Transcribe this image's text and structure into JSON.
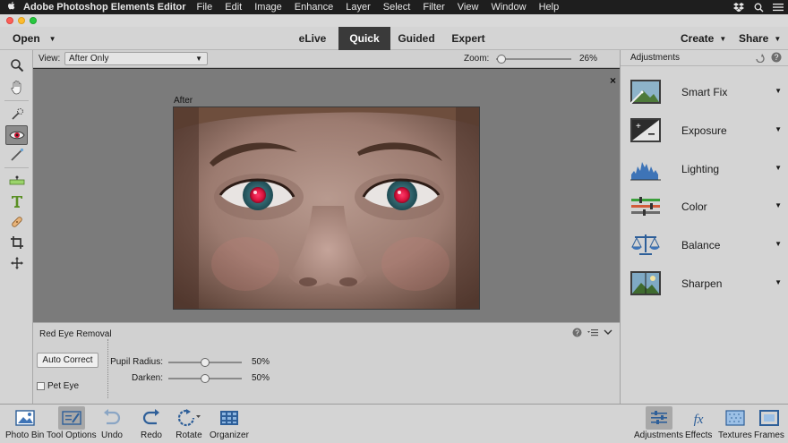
{
  "menubar": {
    "app_name": "Adobe Photoshop Elements Editor",
    "items": [
      "File",
      "Edit",
      "Image",
      "Enhance",
      "Layer",
      "Select",
      "Filter",
      "View",
      "Window",
      "Help"
    ],
    "icons": [
      "dropbox-icon",
      "search-icon",
      "list-icon"
    ]
  },
  "modebar": {
    "open_label": "Open",
    "modes": [
      {
        "label": "eLive",
        "active": false
      },
      {
        "label": "Quick",
        "active": true
      },
      {
        "label": "Guided",
        "active": false
      },
      {
        "label": "Expert",
        "active": false
      }
    ],
    "create_label": "Create",
    "share_label": "Share"
  },
  "viewbar": {
    "view_label": "View:",
    "view_value": "After Only",
    "zoom_label": "Zoom:",
    "zoom_value": "26%"
  },
  "canvas": {
    "after_label": "After",
    "close_label": "×"
  },
  "tool_options": {
    "title": "Red Eye Removal",
    "auto_correct_label": "Auto Correct",
    "pet_eye_label": "Pet Eye",
    "pet_eye_checked": false,
    "sliders": [
      {
        "label": "Pupil Radius:",
        "value": "50%",
        "fraction": 0.5
      },
      {
        "label": "Darken:",
        "value": "50%",
        "fraction": 0.5
      }
    ]
  },
  "adjustments": {
    "title": "Adjustments",
    "items": [
      {
        "label": "Smart Fix",
        "icon": "smart-fix-icon"
      },
      {
        "label": "Exposure",
        "icon": "exposure-icon"
      },
      {
        "label": "Lighting",
        "icon": "lighting-icon"
      },
      {
        "label": "Color",
        "icon": "color-icon"
      },
      {
        "label": "Balance",
        "icon": "balance-icon"
      },
      {
        "label": "Sharpen",
        "icon": "sharpen-icon"
      }
    ]
  },
  "bottombar": {
    "left": [
      {
        "label": "Photo Bin",
        "icon": "photo-bin-icon",
        "active": false
      },
      {
        "label": "Tool Options",
        "icon": "tool-options-icon",
        "active": true
      },
      {
        "label": "Undo",
        "icon": "undo-icon",
        "active": false
      },
      {
        "label": "Redo",
        "icon": "redo-icon",
        "active": false
      },
      {
        "label": "Rotate",
        "icon": "rotate-icon",
        "active": false
      },
      {
        "label": "Organizer",
        "icon": "organizer-icon",
        "active": false
      }
    ],
    "right": [
      {
        "label": "Adjustments",
        "icon": "adjustments-icon",
        "active": true
      },
      {
        "label": "Effects",
        "icon": "effects-icon",
        "active": false
      },
      {
        "label": "Textures",
        "icon": "textures-icon",
        "active": false
      },
      {
        "label": "Frames",
        "icon": "frames-icon",
        "active": false
      }
    ]
  },
  "colors": {
    "accent_active_mode": "#3a3a3a",
    "red_eye": "#e0153a",
    "canvas_bg": "#7b7b7b"
  }
}
